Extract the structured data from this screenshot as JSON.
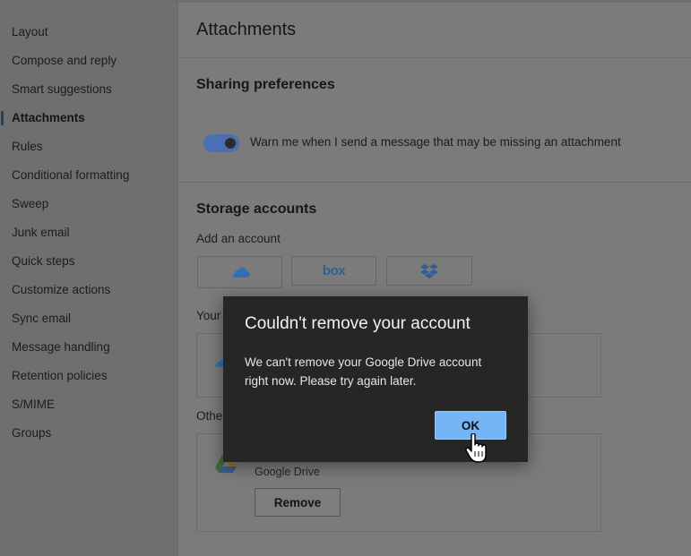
{
  "sidebar": {
    "items": [
      {
        "label": "Layout"
      },
      {
        "label": "Compose and reply"
      },
      {
        "label": "Smart suggestions"
      },
      {
        "label": "Attachments",
        "active": true
      },
      {
        "label": "Rules"
      },
      {
        "label": "Conditional formatting"
      },
      {
        "label": "Sweep"
      },
      {
        "label": "Junk email"
      },
      {
        "label": "Quick steps"
      },
      {
        "label": "Customize actions"
      },
      {
        "label": "Sync email"
      },
      {
        "label": "Message handling"
      },
      {
        "label": "Retention policies"
      },
      {
        "label": "S/MIME"
      },
      {
        "label": "Groups"
      }
    ]
  },
  "main": {
    "title": "Attachments",
    "sharing": {
      "title": "Sharing preferences",
      "toggle_label": "Warn me when I send a message that may be missing an attachment",
      "toggle_on": true
    },
    "storage": {
      "title": "Storage accounts",
      "add_label": "Add an account",
      "providers": [
        {
          "icon": "onedrive-icon"
        },
        {
          "icon": "box-icon",
          "text": "box"
        },
        {
          "icon": "dropbox-icon"
        }
      ],
      "your_accounts_partial": "Your",
      "other_accounts_partial": "Othe",
      "other_account": {
        "icon": "google-drive-icon",
        "name": "Google Drive",
        "remove_label": "Remove"
      }
    }
  },
  "dialog": {
    "title": "Couldn't remove your account",
    "body_line1": "We can't remove your Google Drive account",
    "body_line2": "right now. Please try again later.",
    "ok_label": "OK"
  },
  "colors": {
    "accent": "#75b4f5",
    "dialog_bg": "#262626",
    "overlay_bg": "#7b7b7b"
  }
}
